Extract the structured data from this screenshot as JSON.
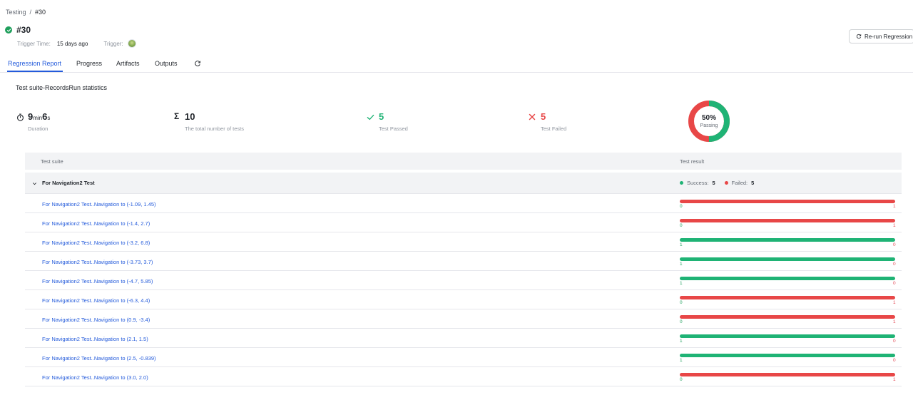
{
  "breadcrumb": {
    "parent": "Testing",
    "separator": "/",
    "current": "#30"
  },
  "run": {
    "title": "#30",
    "trigger_time_label": "Trigger Time:",
    "trigger_time_value": "15 days ago",
    "trigger_label": "Trigger:"
  },
  "actions": {
    "rerun_label": "Re-run Regression"
  },
  "tabs": [
    {
      "label": "Regression Report",
      "active": true
    },
    {
      "label": "Progress",
      "active": false
    },
    {
      "label": "Artifacts",
      "active": false
    },
    {
      "label": "Outputs",
      "active": false
    }
  ],
  "section_title": "Test suite-RecordsRun statistics",
  "stats": {
    "duration": {
      "min": "9",
      "min_unit": "min",
      "sec": "6",
      "sec_unit": "s",
      "label": "Duration"
    },
    "total": {
      "value": "10",
      "label": "The total number of tests"
    },
    "passed": {
      "value": "5",
      "label": "Test Passed"
    },
    "failed": {
      "value": "5",
      "label": "Test Failed"
    },
    "passing": {
      "value": "50%",
      "label": "Passing",
      "fraction": 0.5
    }
  },
  "colors": {
    "success": "#1fb375",
    "failed": "#e84747",
    "accent": "#245bdb"
  },
  "table": {
    "columns": [
      "Test suite",
      "Test result"
    ],
    "group": {
      "name": "For Navigation2 Test",
      "success_label": "Success:",
      "success_count": "5",
      "failed_label": "Failed:",
      "failed_count": "5"
    },
    "rows": [
      {
        "name": "For Navigation2 Test..Navigation to (-1.09, 1.45)",
        "passed": "0",
        "failed": "1"
      },
      {
        "name": "For Navigation2 Test..Navigation to (-1.4, 2.7)",
        "passed": "0",
        "failed": "1"
      },
      {
        "name": "For Navigation2 Test..Navigation to (-3.2, 6.8)",
        "passed": "1",
        "failed": "0"
      },
      {
        "name": "For Navigation2 Test..Navigation to (-3.73, 3.7)",
        "passed": "1",
        "failed": "0"
      },
      {
        "name": "For Navigation2 Test..Navigation to (-4.7, 5.85)",
        "passed": "1",
        "failed": "0"
      },
      {
        "name": "For Navigation2 Test..Navigation to (-6.3, 4.4)",
        "passed": "0",
        "failed": "1"
      },
      {
        "name": "For Navigation2 Test..Navigation to (0.9, -3.4)",
        "passed": "0",
        "failed": "1"
      },
      {
        "name": "For Navigation2 Test..Navigation to (2.1, 1.5)",
        "passed": "1",
        "failed": "0"
      },
      {
        "name": "For Navigation2 Test..Navigation to (2.5, -0.839)",
        "passed": "1",
        "failed": "0"
      },
      {
        "name": "For Navigation2 Test..Navigation to (3.0, 2.0)",
        "passed": "0",
        "failed": "1"
      }
    ]
  }
}
